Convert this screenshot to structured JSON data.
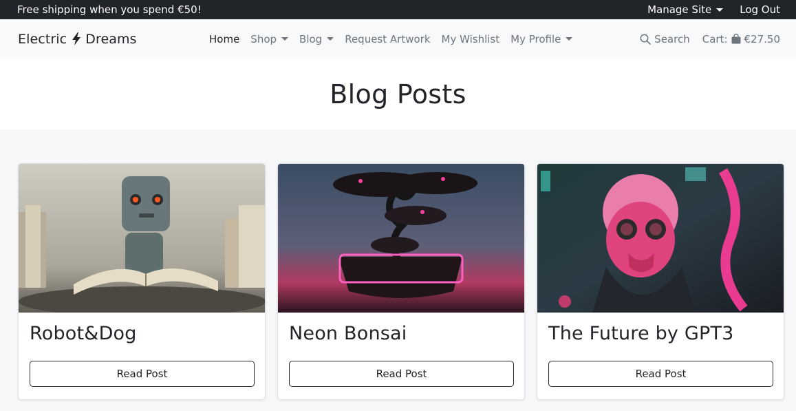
{
  "topbar": {
    "promo": "Free shipping when you spend €50!",
    "manage_site": "Manage Site",
    "log_out": "Log Out"
  },
  "navbar": {
    "brand_left": "Electric",
    "brand_right": "Dreams",
    "brand_icon": "lightning-bolt-icon",
    "links": [
      {
        "label": "Home",
        "active": true,
        "dropdown": false
      },
      {
        "label": "Shop",
        "active": false,
        "dropdown": true
      },
      {
        "label": "Blog",
        "active": false,
        "dropdown": true
      },
      {
        "label": "Request Artwork",
        "active": false,
        "dropdown": false
      },
      {
        "label": "My Wishlist",
        "active": false,
        "dropdown": false
      },
      {
        "label": "My Profile",
        "active": false,
        "dropdown": true
      }
    ],
    "search_label": "Search",
    "cart_label": "Cart:",
    "cart_total": "€27.50"
  },
  "page": {
    "title": "Blog Posts"
  },
  "posts": [
    {
      "title": "Robot&Dog",
      "button": "Read Post",
      "image": "robot-reading-book-image"
    },
    {
      "title": "Neon Bonsai",
      "button": "Read Post",
      "image": "neon-bonsai-image"
    },
    {
      "title": "The Future by GPT3",
      "button": "Read Post",
      "image": "cyberpunk-mask-image"
    }
  ],
  "colors": {
    "topbar_bg": "#212529",
    "navbar_bg": "#f8f9fa",
    "page_bg": "#f6f7f9",
    "muted_text": "#6c757d",
    "neon_pink": "#ff3d9a"
  }
}
